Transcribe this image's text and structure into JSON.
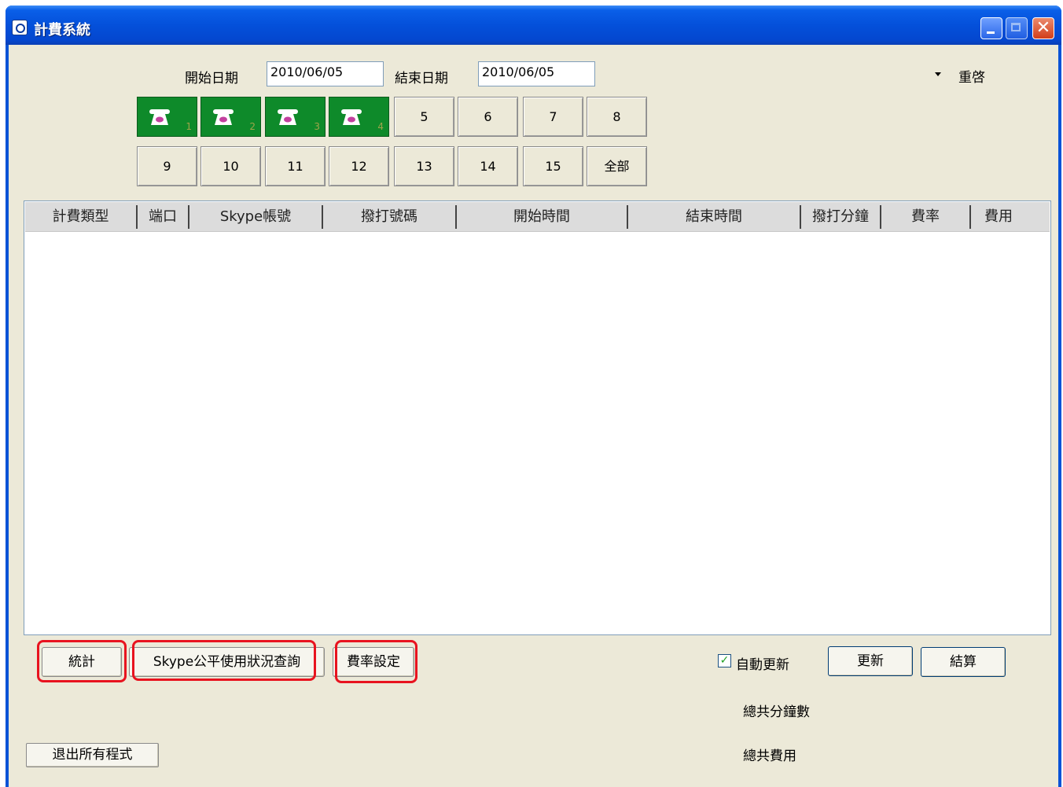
{
  "window": {
    "title": "計費系統",
    "close_glyph": "✕"
  },
  "filters": {
    "start_date_label": "開始日期",
    "start_date_value": "2010/06/05",
    "end_date_label": "結束日期",
    "end_date_value": "2010/06/05",
    "restart_label": "重啓"
  },
  "ports": {
    "active": [
      {
        "num": "1"
      },
      {
        "num": "2"
      },
      {
        "num": "3"
      },
      {
        "num": "4"
      }
    ],
    "buttons": [
      "5",
      "6",
      "7",
      "8",
      "9",
      "10",
      "11",
      "12",
      "13",
      "14",
      "15",
      "全部"
    ],
    "active_color": "#0e8a2a"
  },
  "table": {
    "columns": [
      "計費類型",
      "端口",
      "Skype帳號",
      "撥打號碼",
      "開始時間",
      "結束時間",
      "撥打分鐘",
      "費率",
      "費用"
    ],
    "rows": []
  },
  "actions": {
    "stats": "統計",
    "skype_query": "Skype公平使用狀況查詢",
    "rate_settings": "費率設定",
    "auto_update_label": "自動更新",
    "auto_update_checked": true,
    "update": "更新",
    "settle": "結算",
    "exit": "退出所有程式"
  },
  "summary": {
    "total_minutes_label": "總共分鐘數",
    "total_cost_label": "總共費用"
  },
  "highlight_color": "#e8131f"
}
